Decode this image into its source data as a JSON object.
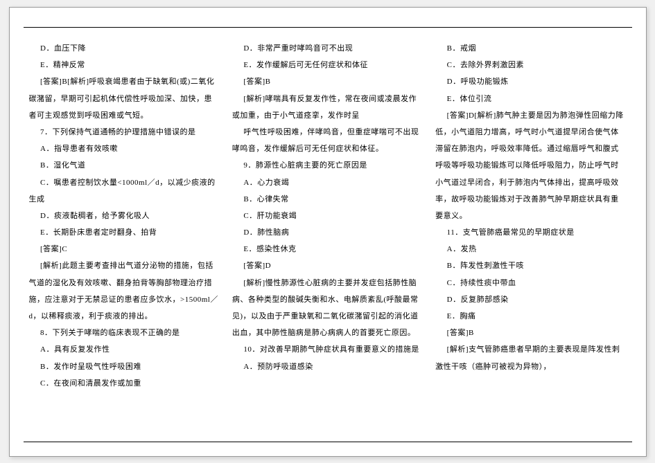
{
  "columns": [
    [
      "D．血压下降",
      "E．精神反常",
      "[答案]B[解析]呼吸衰竭患者由于缺氧和(或)二氧化碳潴留，早期可引起机体代偿性呼吸加深、加快，患者可主观感觉到呼吸困难或气短。",
      "7．下列保持气道通畅的护理措施中错误的是",
      "A．指导患者有效咳嗽",
      "B．湿化气道",
      "C．嘱患者控制饮水量<1000ml／d，以减少痰液的生成",
      "D．痰液黏稠者，给予雾化吸人",
      "E．长期卧床患者定时翻身、拍背",
      "[答案]C",
      "[解析]此题主要考查排出气道分泌物的措施，包括气道的湿化及有效咳嗽、翻身拍背等胸部物理治疗措施，应注意对于无禁忌证的患者应多饮水，>1500ml／d，以稀释痰液，利于痰液的排出。",
      "8．下列关于哮喘的临床表现不正确的是",
      "A．具有反复发作性",
      "B．发作时呈吸气性呼吸困难",
      "C．在夜间和清晨发作或加重"
    ],
    [
      "D．非常严重时哮鸣音可不出现",
      "E．发作缓解后可无任何症状和体征",
      "[答案]B",
      "[解析]哮喘具有反复发作性，常在夜间或凌晨发作或加重，由于小气道痉挛，发作时呈",
      "呼气性呼吸困难，伴哮鸣音，但重症哮喘可不出现哮鸣音，发作缓解后可无任何症状和体征。",
      "9．肺源性心脏病主要的死亡原因是",
      "A．心力衰竭",
      "B．心律失常",
      "C．肝功能衰竭",
      "D．肺性脑病",
      "E．感染性休克",
      "[答案]D",
      "[解析]慢性肺源性心脏病的主要并发症包括肺性脑病、各种类型的酸碱失衡和水、电解质紊乱(呼酸最常见)，以及由于严重缺氧和二氧化碳潴留引起的消化道出血，其中肺性脑病是肺心病病人的首要死亡原因。",
      "10．对改善早期肺气肿症状具有重要意义的措施是",
      "A．预防呼吸道感染"
    ],
    [
      "B．戒烟",
      "C．去除外界刺激因素",
      "D．呼吸功能锻炼",
      "E．体位引流",
      "[答案]D[解析]肺气肿主要是因为肺泡弹性回缩力降低，小气道阻力增高，呼气时小气道提早闭合使气体滞留在肺泡内，呼吸效率降低。通过缩唇呼气和腹式呼吸等呼吸功能锻炼可以降低呼吸阻力，防止呼气时小气道过早闭合，利于肺泡内气体排出，提高呼吸效率，故呼吸功能锻炼对于改善肺气肿早期症状具有重要意义。",
      "11．支气管肺癌最常见的早期症状是",
      "A．发热",
      "B．阵发性刺激性干咳",
      "C．持续性痰中带血",
      "D．反复肺部感染",
      "E．胸痛",
      "[答案]B",
      "[解析]支气管肺癌患者早期的主要表现是阵发性刺激性干咳（癌肿可被视为异物），"
    ]
  ]
}
